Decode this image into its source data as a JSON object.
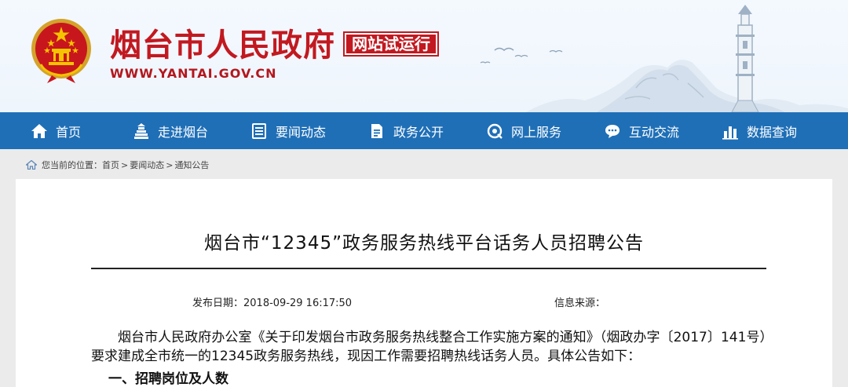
{
  "header": {
    "site_title": "烟台市人民政府",
    "trial_badge": "网站试运行",
    "site_url": "WWW.YANTAI.GOV.CN",
    "brand_color": "#c21920"
  },
  "nav": {
    "background": "#1f6fb7",
    "items": [
      {
        "label": "首页",
        "icon": "home-icon"
      },
      {
        "label": "走进烟台",
        "icon": "building-icon"
      },
      {
        "label": "要闻动态",
        "icon": "news-icon"
      },
      {
        "label": "政务公开",
        "icon": "document-icon"
      },
      {
        "label": "网上服务",
        "icon": "service-icon"
      },
      {
        "label": "互动交流",
        "icon": "chat-icon"
      },
      {
        "label": "数据查询",
        "icon": "bar-chart-icon"
      }
    ]
  },
  "breadcrumb": {
    "prefix": "您当前的位置：",
    "items": [
      "首页",
      "要闻动态",
      "通知公告"
    ],
    "separator": ">"
  },
  "article": {
    "title": "烟台市“12345”政务服务热线平台话务人员招聘公告",
    "publish_date": "发布日期：2018-09-29 16:17:50",
    "source": "信息来源：",
    "paragraph": "烟台市人民政府办公室《关于印发烟台市政务服务热线整合工作实施方案的通知》（烟政办字〔2017〕141号）要求建成全市统一的12345政务服务热线，现因工作需要招聘热线话务人员。具体公告如下：",
    "section_heading": "一、招聘岗位及人数"
  }
}
